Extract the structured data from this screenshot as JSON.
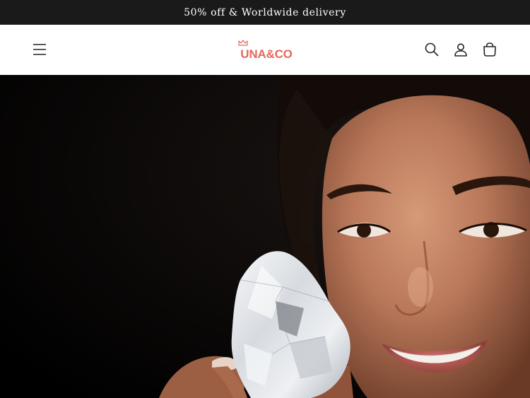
{
  "announcement": {
    "text": "50% off & Worldwide delivery"
  },
  "header": {
    "logo_text": "UNA&CO",
    "brand_color": "#e4685b",
    "icons": [
      "menu-icon",
      "search-icon",
      "account-icon",
      "cart-icon"
    ]
  },
  "hero": {
    "image_subject": "woman-holding-rough-diamond"
  }
}
